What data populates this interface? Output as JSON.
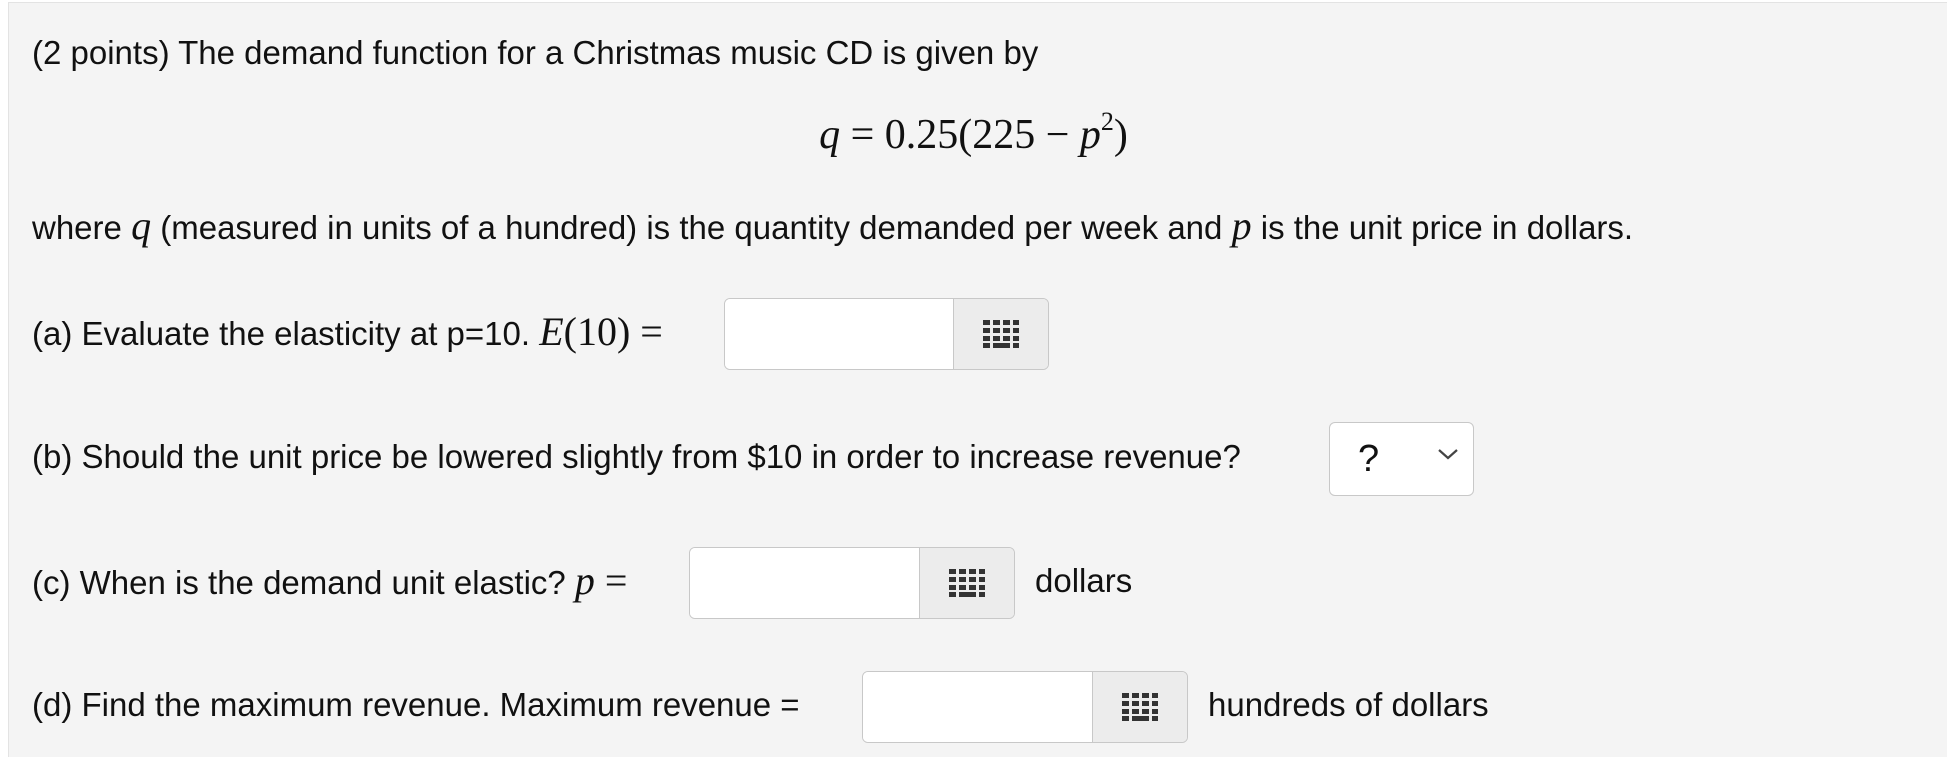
{
  "problem": {
    "intro": "(2 points) The demand function for a Christmas music CD is given by",
    "formula": {
      "lhs": "q",
      "eq": " = 0.25(225 − ",
      "var": "p",
      "exp": "2",
      "close": ")"
    },
    "where": {
      "w1": "where ",
      "q": "q",
      "w2": " (measured in units of a hundred) is the quantity demanded per week and ",
      "p": "p",
      "w3": " is the unit price in dollars."
    }
  },
  "part_a": {
    "label": "(a) Evaluate the elasticity at p=10. ",
    "math_fn": "E",
    "math_arg": "(10)",
    "math_eq": " =",
    "input_value": "",
    "keypad_icon": "keypad-grid-icon"
  },
  "part_b": {
    "label": "(b) Should the unit price be lowered slightly from $10 in order to increase revenue?",
    "select_value": "?",
    "chevron_icon": "chevron-down-icon"
  },
  "part_c": {
    "label": "(c) When is the demand unit elastic? ",
    "math_var": "p",
    "math_eq": " =",
    "input_value": "",
    "unit": "dollars",
    "keypad_icon": "keypad-grid-icon"
  },
  "part_d": {
    "label": "(d) Find the maximum revenue. Maximum revenue =",
    "input_value": "",
    "unit": "hundreds of dollars",
    "keypad_icon": "keypad-grid-icon"
  }
}
